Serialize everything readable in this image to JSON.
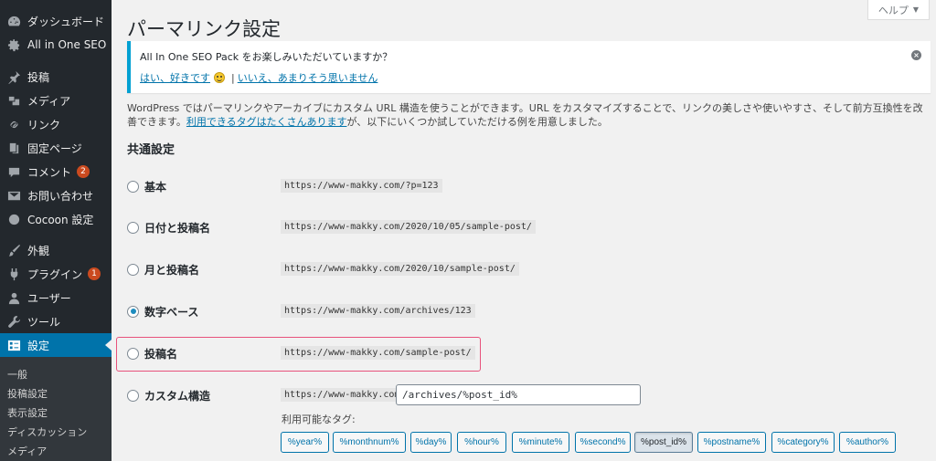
{
  "sidebar": {
    "items": [
      {
        "label": "ダッシュボード",
        "icon": "dashboard-icon"
      },
      {
        "label": "All in One SEO",
        "icon": "gear-icon"
      },
      {
        "label": "投稿",
        "icon": "pin-icon"
      },
      {
        "label": "メディア",
        "icon": "media-icon"
      },
      {
        "label": "リンク",
        "icon": "link-icon"
      },
      {
        "label": "固定ページ",
        "icon": "page-icon"
      },
      {
        "label": "コメント",
        "icon": "comment-icon",
        "badge": "2"
      },
      {
        "label": "お問い合わせ",
        "icon": "mail-icon"
      },
      {
        "label": "Cocoon 設定",
        "icon": "circle-icon"
      },
      {
        "label": "外観",
        "icon": "brush-icon"
      },
      {
        "label": "プラグイン",
        "icon": "plugin-icon",
        "badge": "1"
      },
      {
        "label": "ユーザー",
        "icon": "user-icon"
      },
      {
        "label": "ツール",
        "icon": "wrench-icon"
      },
      {
        "label": "設定",
        "icon": "settings-icon",
        "active": true
      }
    ],
    "submenu": [
      "一般",
      "投稿設定",
      "表示設定",
      "ディスカッション",
      "メディア"
    ]
  },
  "help_tab": "ヘルプ",
  "page_title": "パーマリンク設定",
  "notice": {
    "text": "All In One SEO Pack をお楽しみいただいていますか？",
    "link_yes": "はい、好きです",
    "separator": "|",
    "link_no": "いいえ、あまりそう思いません",
    "close": "×"
  },
  "intro": {
    "text": "WordPress ではパーマリンクやアーカイブにカスタム URL 構造を使うことができます。URL をカスタマイズすることで、リンクの美しさや使いやすさ、そして前方互換性を改善できます。",
    "link": "利用できるタグはたくさんあります",
    "text_after": "が、以下にいくつか試していただける例を用意しました。"
  },
  "section_title": "共通設定",
  "options": [
    {
      "label": "基本",
      "example": "https://www-makky.com/?p=123",
      "checked": false
    },
    {
      "label": "日付と投稿名",
      "example": "https://www-makky.com/2020/10/05/sample-post/",
      "checked": false
    },
    {
      "label": "月と投稿名",
      "example": "https://www-makky.com/2020/10/sample-post/",
      "checked": false
    },
    {
      "label": "数字ベース",
      "example": "https://www-makky.com/archives/123",
      "checked": true
    },
    {
      "label": "投稿名",
      "example": "https://www-makky.com/sample-post/",
      "checked": false
    },
    {
      "label": "カスタム構造",
      "example": "https://www-makky.com",
      "checked": false
    }
  ],
  "custom_value": "/archives/%post_id%",
  "tags_label": "利用可能なタグ:",
  "tags": [
    "%year%",
    "%monthnum%",
    "%day%",
    "%hour%",
    "%minute%",
    "%second%",
    "%post_id%",
    "%postname%",
    "%category%",
    "%author%"
  ],
  "active_tag": "%post_id%",
  "colors": {
    "accent": "#0073aa",
    "highlight": "#e8527c",
    "sidebar": "#23282d"
  }
}
